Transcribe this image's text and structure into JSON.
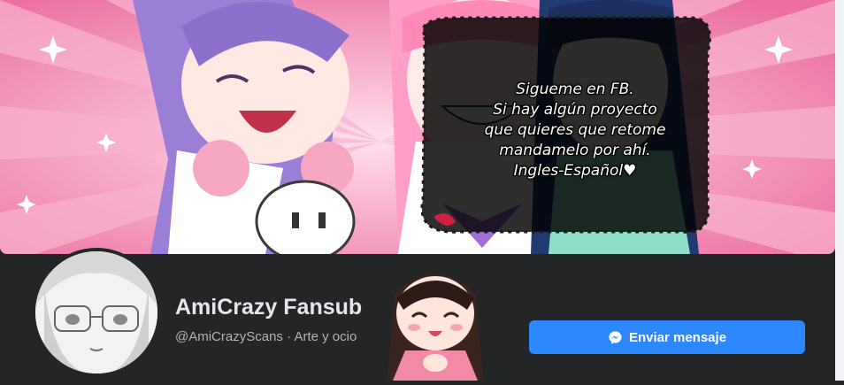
{
  "cover": {
    "bubble_lines": [
      "Sigueme en FB.",
      "Si hay algún proyecto",
      "que quieres que retome",
      "mandamelo por ahí.",
      "Ingles-Español♥"
    ]
  },
  "profile": {
    "name": "AmiCrazy Fansub",
    "handle": "@AmiCrazyScans",
    "separator": " · ",
    "category": "Arte y ocio"
  },
  "actions": {
    "send_message_label": "Enviar mensaje",
    "send_message_icon": "messenger-icon"
  },
  "colors": {
    "background": "#242526",
    "primary_button": "#2d88ff",
    "cover_pink": "#f08ab0"
  }
}
